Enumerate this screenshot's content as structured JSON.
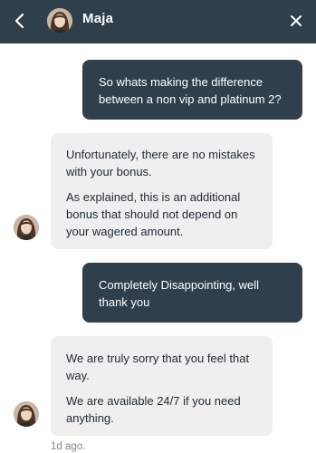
{
  "header": {
    "agent_name": "Maja"
  },
  "icons": {
    "back": "chevron-left-icon",
    "close": "close-icon",
    "avatar": "agent-avatar"
  },
  "messages": [
    {
      "sender": "user",
      "paragraphs": [
        "So whats making the difference between a non vip and platinum 2?"
      ]
    },
    {
      "sender": "agent",
      "paragraphs": [
        "Unfortunately, there are no mistakes with your bonus.",
        "As explained, this is an additional bonus that should not depend on your wagered amount."
      ]
    },
    {
      "sender": "user",
      "paragraphs": [
        "Completely Disappointing, well thank you"
      ]
    },
    {
      "sender": "agent",
      "paragraphs": [
        "We are truly sorry that you feel that way.",
        "We are available 24/7 if you need anything."
      ]
    }
  ],
  "last_message_time": "1d ago.",
  "colors": {
    "header_bg": "#2f3f4c",
    "outgoing_bubble": "#2f3f4c",
    "incoming_bubble": "#efefef",
    "timestamp": "#7b8690"
  }
}
